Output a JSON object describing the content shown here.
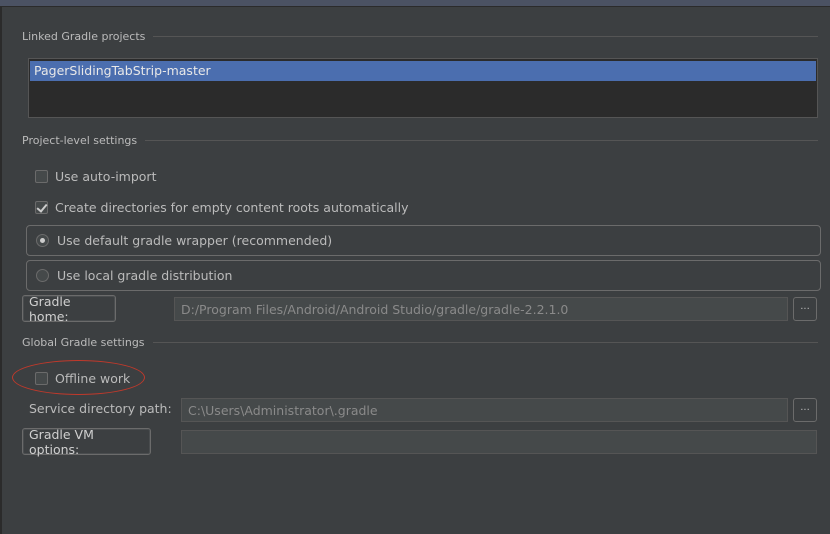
{
  "linked": {
    "title": "Linked Gradle projects",
    "projects": [
      "PagerSlidingTabStrip-master"
    ]
  },
  "project_level": {
    "title": "Project-level settings",
    "auto_import": {
      "label": "Use auto-import",
      "checked": false
    },
    "create_dirs": {
      "label": "Create directories for empty content roots automatically",
      "checked": true
    },
    "wrapper": {
      "label": "Use default gradle wrapper (recommended)",
      "selected": true
    },
    "local": {
      "label": "Use local gradle distribution",
      "selected": false
    },
    "gradle_home": {
      "button": "Gradle home:",
      "value": "D:/Program Files/Android/Android Studio/gradle/gradle-2.2.1.0"
    }
  },
  "global": {
    "title": "Global Gradle settings",
    "offline": {
      "label": "Offline work",
      "checked": false
    },
    "service_dir": {
      "label": "Service directory path:",
      "value": "C:\\Users\\Administrator\\.gradle"
    },
    "vm_options": {
      "button": "Gradle VM options:",
      "value": ""
    }
  },
  "browse_glyph": "···",
  "colors": {
    "accent": "#4b6eaf",
    "highlight": "#c0392b"
  }
}
